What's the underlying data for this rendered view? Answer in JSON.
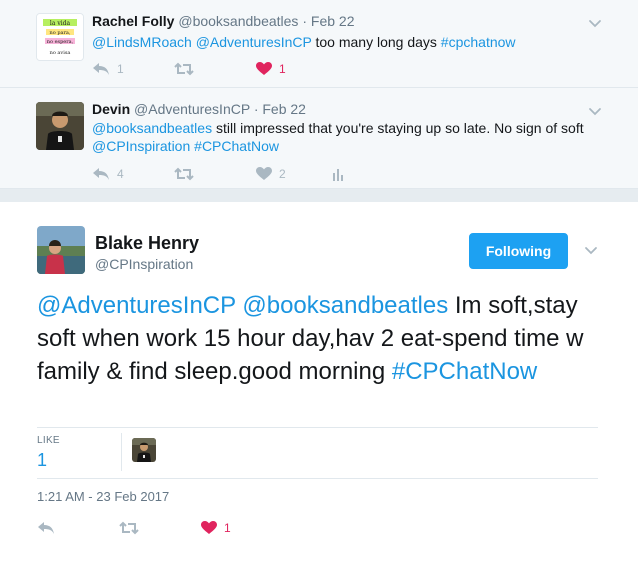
{
  "replies": [
    {
      "name": "Rachel Folly",
      "handle": "@booksandbeatles",
      "dot": "·",
      "time": "Feb 22",
      "avatar_lines": [
        "la vida",
        "no para,",
        "no espera,",
        "no avisa"
      ],
      "mentions": [
        "@LindsMRoach",
        "@AdventuresInCP"
      ],
      "text": "too many long days",
      "hashtag": "#cpchatnow",
      "reply_count": "1",
      "like_count": "1"
    },
    {
      "name": "Devin",
      "handle": "@AdventuresInCP",
      "dot": "·",
      "time": "Feb 22",
      "mention": "@booksandbeatles",
      "text": "still impressed that you're staying up so late. No sign of soft",
      "mention2": "@CPInspiration",
      "hashtag": "#CPChatNow",
      "reply_count": "4",
      "like_count": "2"
    }
  ],
  "main": {
    "name": "Blake Henry",
    "handle": "@CPInspiration",
    "follow_label": "Following",
    "mention1": "@AdventuresInCP",
    "mention2": "@booksandbeatles",
    "text": "Im soft,stay soft when work 15 hour day,hav 2 eat-spend time w family & find sleep.good morning",
    "hashtag": "#CPChatNow",
    "likes_label": "LIKE",
    "likes_count": "1",
    "timestamp": "1:21 AM - 23 Feb 2017",
    "like_action_count": "1"
  },
  "colors": {
    "accent": "#1da1f2",
    "link": "#1b95e0",
    "like": "#e0245e",
    "muted": "#657786",
    "icon": "#aab8c2"
  },
  "icons": [
    "reply-icon",
    "retweet-icon",
    "heart-icon",
    "analytics-icon",
    "chevron-down-icon"
  ]
}
